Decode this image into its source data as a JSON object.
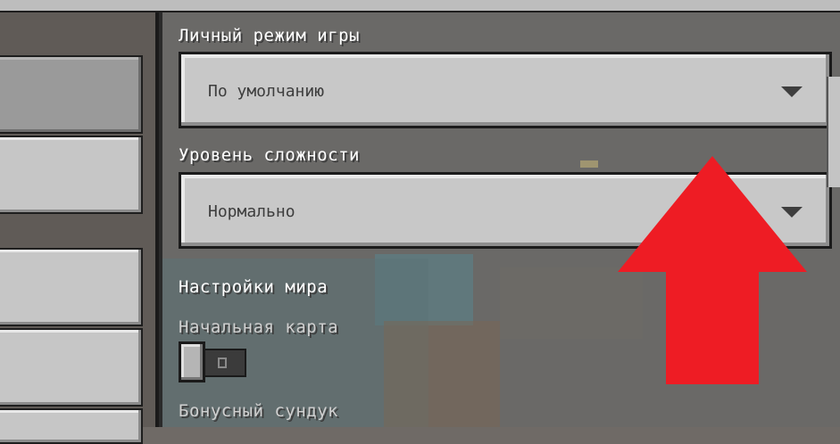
{
  "settings": {
    "personal_game_mode": {
      "label": "Личный режим игры",
      "value": "По умолчанию"
    },
    "difficulty": {
      "label": "Уровень сложности",
      "value": "Нормально"
    },
    "world_section_title": "Настройки мира",
    "starting_map": {
      "label": "Начальная карта",
      "enabled": false
    },
    "bonus_chest": {
      "label": "Бонусный сундук"
    }
  },
  "colors": {
    "annotation_arrow": "#ee1c24",
    "button_face": "#c6c6c6",
    "text_light": "#ffffff"
  },
  "icons": {
    "dropdown": "chevron-down-icon"
  }
}
